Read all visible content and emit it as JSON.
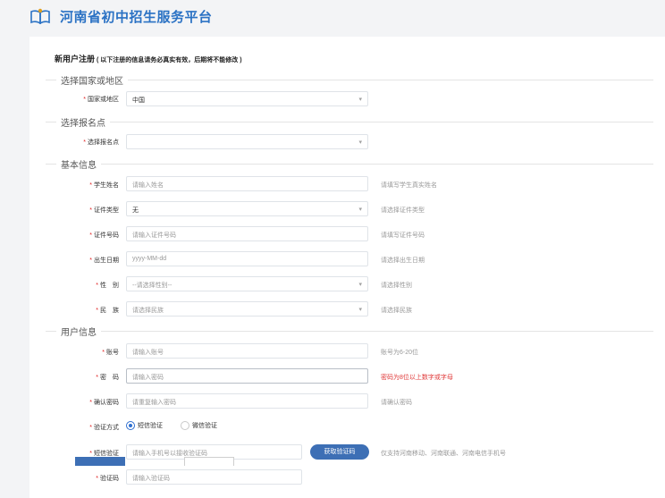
{
  "header": {
    "site_title": "河南省初中招生服务平台",
    "logo_icon": "book-logo-icon",
    "accent": "#2b72c4"
  },
  "form": {
    "title": "新用户注册",
    "note": "( 以下注册的信息请务必真实有效，后期将不能修改 )",
    "required_mark": "*",
    "sections": {
      "country": "选择国家或地区",
      "site": "选择报名点",
      "basic": "基本信息",
      "user": "用户信息"
    },
    "fields": {
      "country": {
        "label": "国家或地区",
        "value": "中国"
      },
      "site": {
        "label": "选择报名点",
        "value": ""
      },
      "name": {
        "label": "学生姓名",
        "placeholder": "请输入姓名",
        "hint": "请填写学生真实姓名"
      },
      "id_type": {
        "label": "证件类型",
        "value": "无",
        "hint": "请选择证件类型"
      },
      "id_number": {
        "label": "证件号码",
        "placeholder": "请输入证件号码",
        "hint": "请填写证件号码"
      },
      "birth": {
        "label": "出生日期",
        "placeholder": "yyyy-MM-dd",
        "hint": "请选择出生日期"
      },
      "gender": {
        "label": "性　别",
        "value": "--请选择性别--",
        "hint": "请选择性别"
      },
      "ethnicity": {
        "label": "民　族",
        "value": "请选择民族",
        "hint": "请选择民族"
      },
      "account": {
        "label": "账号",
        "placeholder": "请输入账号",
        "hint": "账号为6-20位"
      },
      "password": {
        "label": "密　码",
        "placeholder": "请输入密码",
        "hint": "密码为8位以上数字或字母"
      },
      "confirm": {
        "label": "确认密码",
        "placeholder": "请重复输入密码",
        "hint": "请确认密码"
      },
      "verify_method": {
        "label": "验证方式",
        "options": [
          "短信验证",
          "微信验证"
        ],
        "selected": "短信验证"
      },
      "sms_code": {
        "label": "短信验证",
        "placeholder": "请输入手机号以接收验证码",
        "button": "获取验证码",
        "hint": "仅支持河南移动、河南联通、河南电信手机号"
      },
      "captcha": {
        "label": "验证码",
        "placeholder": "请输入验证码"
      }
    }
  }
}
